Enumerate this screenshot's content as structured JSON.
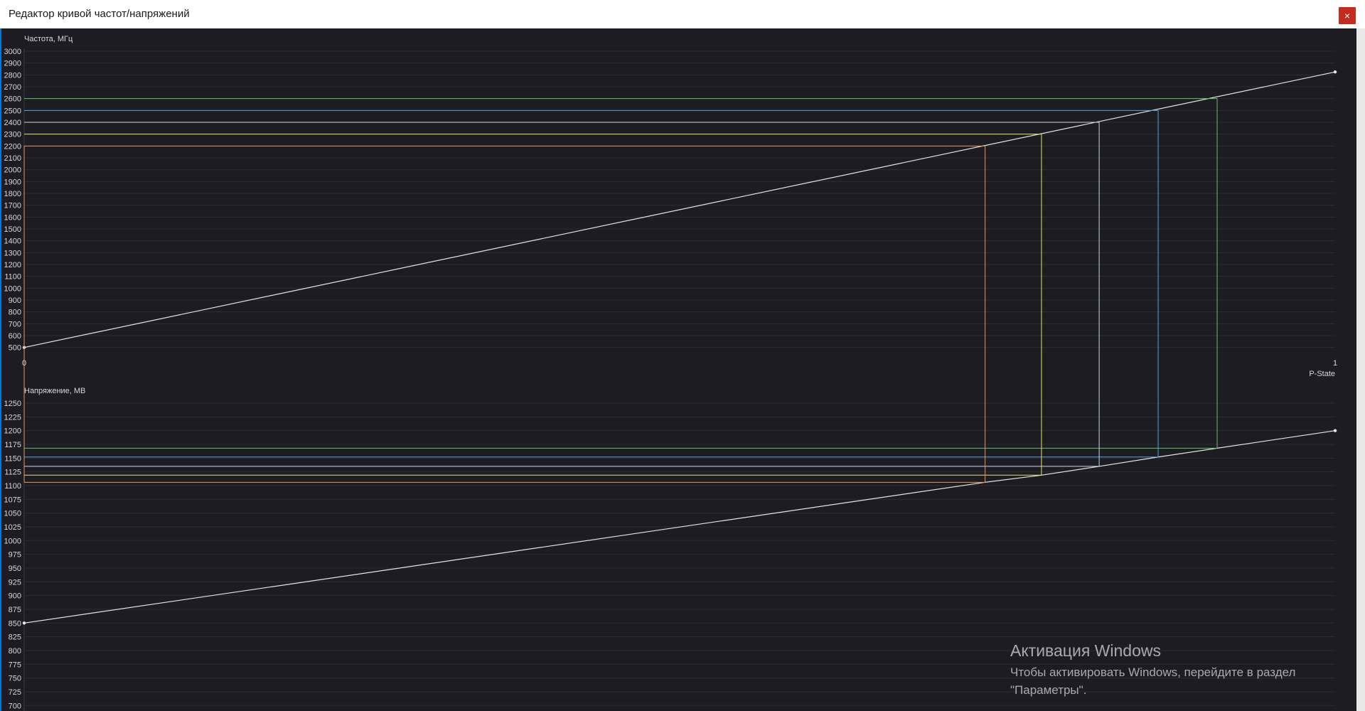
{
  "window": {
    "title": "Редактор кривой частот/напряжений",
    "close_label": "×"
  },
  "watermark": {
    "title": "Активация Windows",
    "line1": "Чтобы активировать Windows, перейдите в раздел",
    "line2": "\"Параметры\"."
  },
  "colors": {
    "background": "#1c1c22",
    "grid": "#2c2c34",
    "axis_text": "#d8d8d8",
    "curve": "#e6e6e6",
    "orange": "#e8955a",
    "yellow": "#e8e36a",
    "white_blue": "#c4d6ef",
    "blue": "#4aa6e0",
    "green": "#5ec85c"
  },
  "chart_data": [
    {
      "type": "line",
      "ylabel": "Частота, МГц",
      "xlabel": "P-State",
      "x_ticks": [
        "0",
        "1"
      ],
      "xlim": [
        0,
        1
      ],
      "ylim": [
        450,
        3000
      ],
      "y_ticks": [
        500,
        600,
        700,
        800,
        900,
        1000,
        1100,
        1200,
        1300,
        1400,
        1500,
        1600,
        1700,
        1800,
        1900,
        2000,
        2100,
        2200,
        2300,
        2400,
        2500,
        2600,
        2700,
        2800,
        2900,
        3000
      ],
      "grid": true,
      "series": [
        {
          "x": [
            0,
            1
          ],
          "y": [
            500,
            2825
          ]
        }
      ],
      "markers": [
        {
          "color": "orange",
          "x": 0.733,
          "y": 2200
        },
        {
          "color": "yellow",
          "x": 0.776,
          "y": 2300
        },
        {
          "color": "white_blue",
          "x": 0.82,
          "y": 2400
        },
        {
          "color": "blue",
          "x": 0.865,
          "y": 2500
        },
        {
          "color": "green",
          "x": 0.91,
          "y": 2600
        }
      ]
    },
    {
      "type": "line",
      "ylabel": "Напряжение, МВ",
      "x_ticks": [
        "0",
        "1"
      ],
      "xlim": [
        0,
        1
      ],
      "ylim": [
        690,
        1250
      ],
      "y_ticks": [
        700,
        725,
        750,
        775,
        800,
        825,
        850,
        875,
        900,
        925,
        950,
        975,
        1000,
        1025,
        1050,
        1075,
        1100,
        1125,
        1150,
        1175,
        1200,
        1225,
        1250
      ],
      "grid": true,
      "series": [
        {
          "x": [
            0,
            0.733,
            0.776,
            0.82,
            0.865,
            0.91,
            1
          ],
          "y": [
            850,
            1106,
            1119,
            1135,
            1152,
            1168,
            1200
          ]
        }
      ],
      "markers": [
        {
          "color": "orange",
          "x": 0.733,
          "y": 1106
        },
        {
          "color": "yellow",
          "x": 0.776,
          "y": 1119
        },
        {
          "color": "white_blue",
          "x": 0.82,
          "y": 1135
        },
        {
          "color": "blue",
          "x": 0.865,
          "y": 1152
        },
        {
          "color": "green",
          "x": 0.91,
          "y": 1168
        }
      ]
    }
  ]
}
